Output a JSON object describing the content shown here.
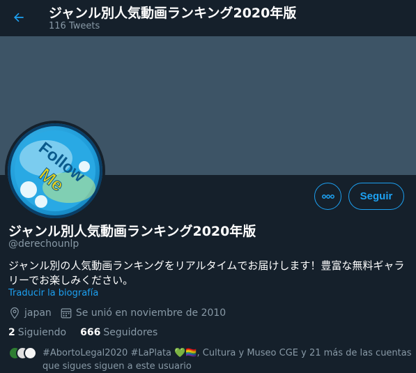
{
  "header": {
    "title": "ジャンル別人気動画ランキング2020年版",
    "tweet_count": "116 Tweets"
  },
  "profile": {
    "name": "ジャンル別人気動画ランキング2020年版",
    "handle": "@derechounlp",
    "bio": "ジャンル別の人気動画ランキングをリアルタイムでお届けします！豊富な無料ギャラリーでお楽しみください。",
    "translate_label": "Traducir la biografía",
    "location": "japan",
    "joined": "Se unió en noviembre de 2010",
    "following_count": "2",
    "following_label": "Siguiendo",
    "followers_count": "666",
    "followers_label": "Seguidores",
    "avatar_text_1": "Follow",
    "avatar_text_2": "Me"
  },
  "actions": {
    "follow_label": "Seguir"
  },
  "followed_by": {
    "text": "#AbortoLegal2020 #LaPlata 💚🏳️‍🌈, Cultura y Museo CGE y 21 más de las cuentas que sigues siguen a este usuario"
  },
  "colors": {
    "background": "#15202b",
    "banner": "#3d5466",
    "accent": "#1da1f2",
    "secondary_text": "#8899a6"
  },
  "icons": {
    "back": "arrow-left-icon",
    "more": "more-dots-icon",
    "location": "location-pin-icon",
    "calendar": "calendar-icon"
  }
}
